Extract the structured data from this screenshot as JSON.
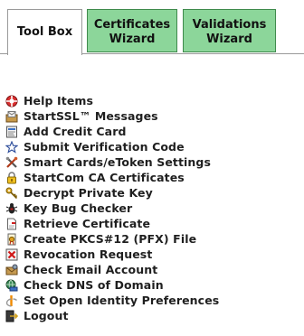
{
  "tabs": [
    {
      "line1": "Tool Box",
      "line2": ""
    },
    {
      "line1": "Certificates",
      "line2": "Wizard"
    },
    {
      "line1": "Validations",
      "line2": "Wizard"
    }
  ],
  "menu": [
    {
      "label": "Help Items",
      "icon": "lifebuoy-icon"
    },
    {
      "label": "StartSSL™ Messages",
      "icon": "mail-folder-icon"
    },
    {
      "label": "Add Credit Card",
      "icon": "credit-card-icon"
    },
    {
      "label": "Submit Verification Code",
      "icon": "star-icon"
    },
    {
      "label": "Smart Cards/eToken Settings",
      "icon": "tools-icon"
    },
    {
      "label": "StartCom CA Certificates",
      "icon": "lock-icon"
    },
    {
      "label": "Decrypt Private Key",
      "icon": "key-icon"
    },
    {
      "label": "Key Bug Checker",
      "icon": "bug-icon"
    },
    {
      "label": "Retrieve Certificate",
      "icon": "document-icon"
    },
    {
      "label": "Create PKCS#12 (PFX) File",
      "icon": "certificate-file-icon"
    },
    {
      "label": "Revocation Request",
      "icon": "revoke-icon"
    },
    {
      "label": "Check Email Account",
      "icon": "email-check-icon"
    },
    {
      "label": "Check DNS of Domain",
      "icon": "dns-icon"
    },
    {
      "label": "Set Open Identity Preferences",
      "icon": "openid-icon"
    },
    {
      "label": "Logout",
      "icon": "logout-icon"
    }
  ]
}
